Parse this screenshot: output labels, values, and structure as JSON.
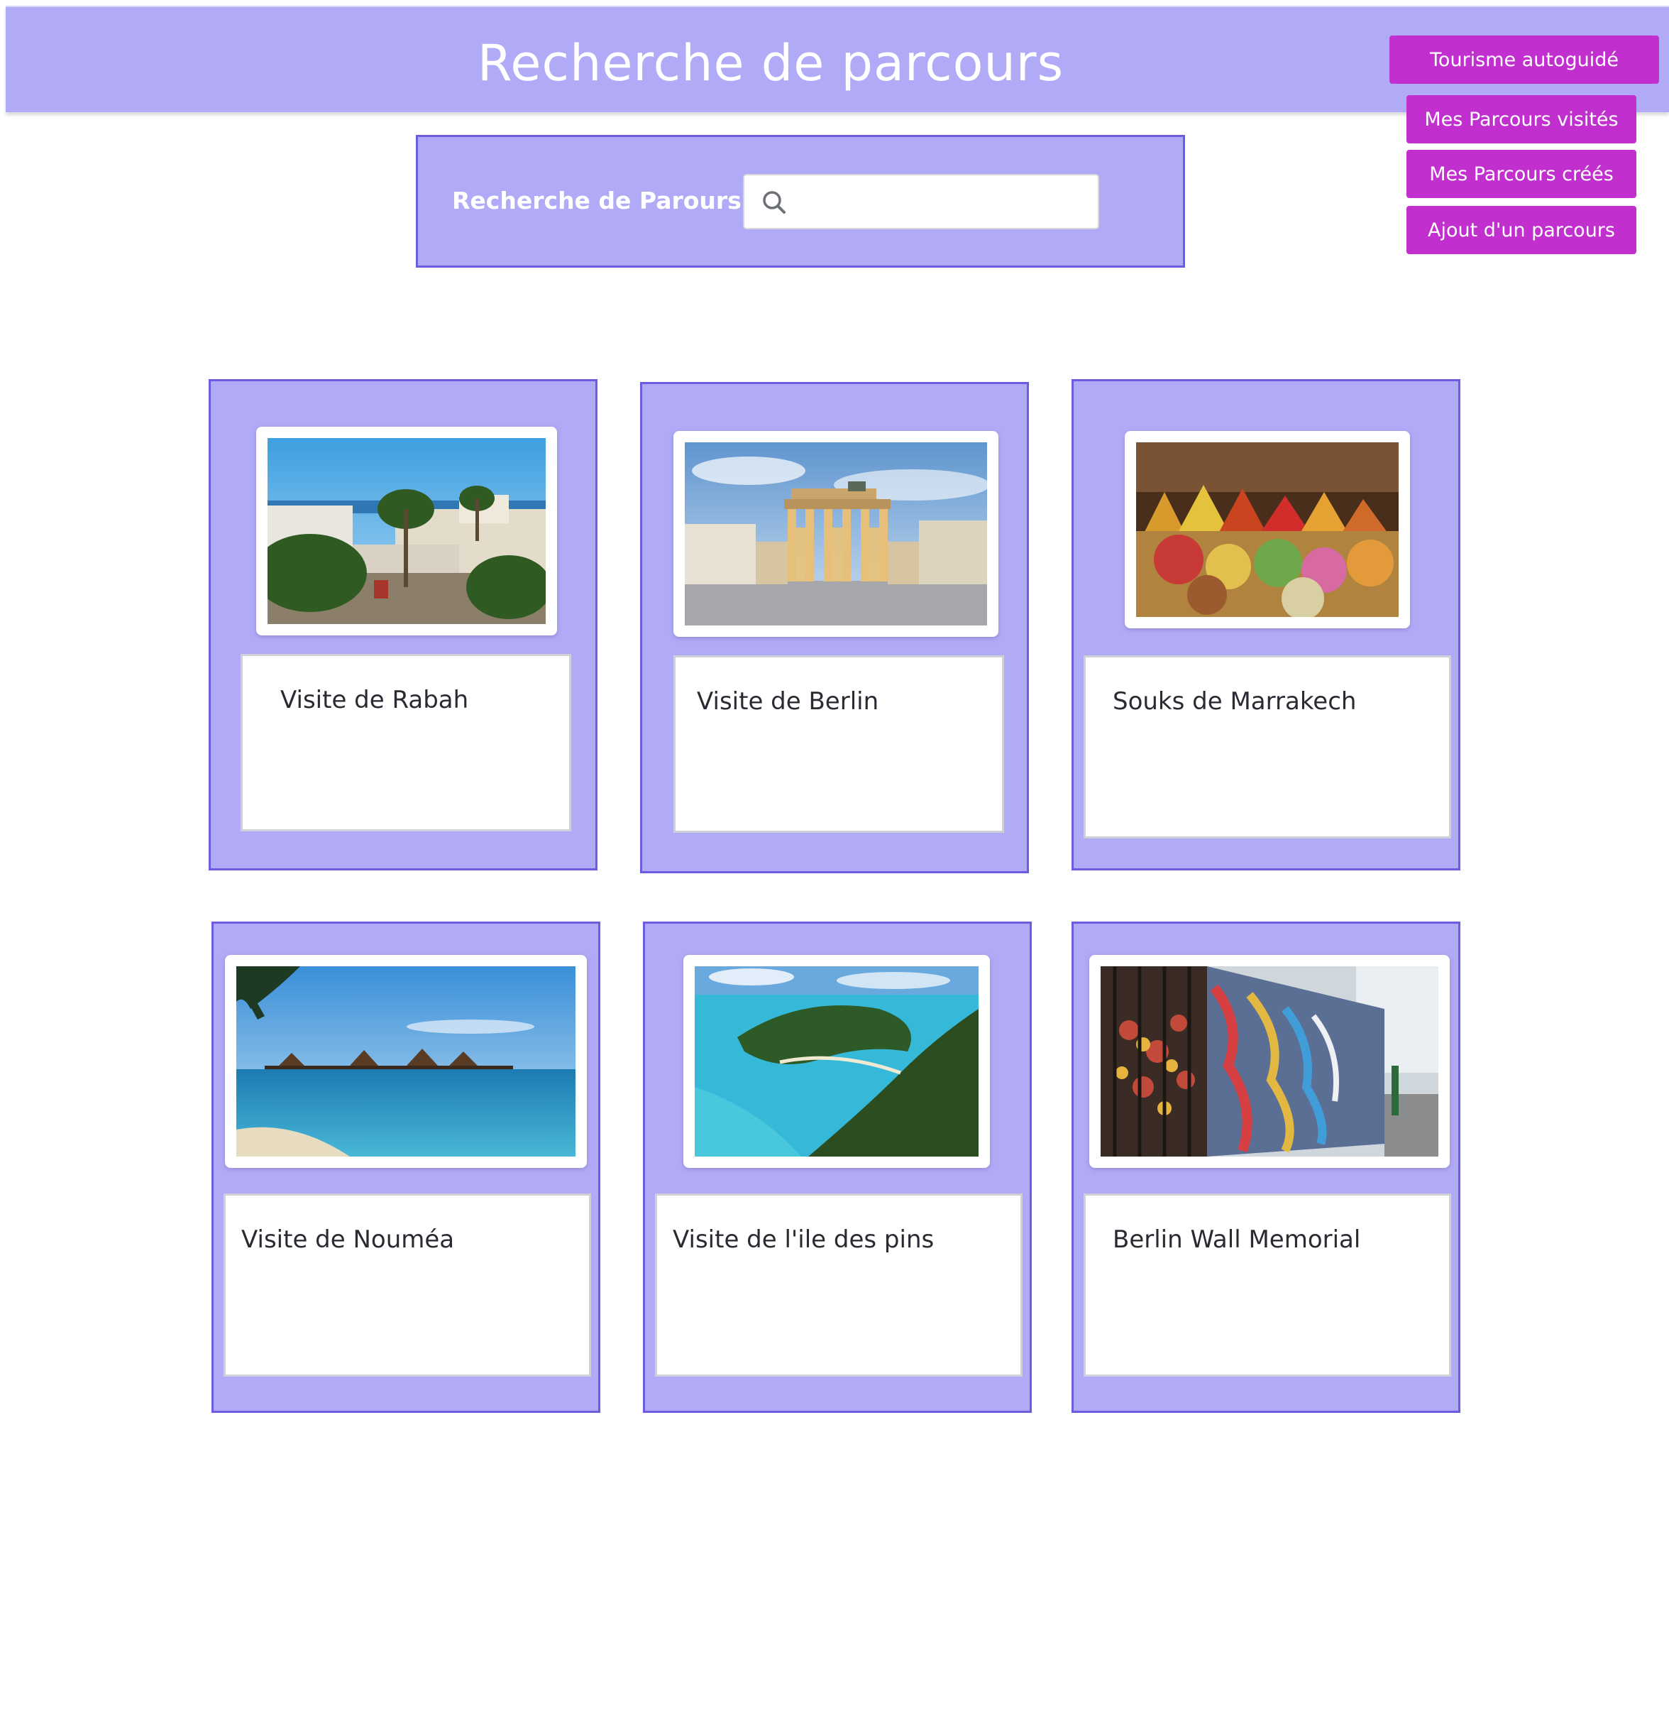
{
  "header": {
    "title": "Recherche de parcours"
  },
  "nav": {
    "tourisme": "Tourisme autoguidé",
    "visites": "Mes Parcours visités",
    "crees": "Mes Parcours créés",
    "ajout": "Ajout d'un parcours"
  },
  "search": {
    "label": "Recherche de Parours",
    "placeholder": "",
    "value": ""
  },
  "cards": [
    {
      "title": "Visite de Rabah",
      "image": "rabat-palm-city-photo"
    },
    {
      "title": "Visite de Berlin",
      "image": "brandenburg-gate-photo"
    },
    {
      "title": "Souks de Marrakech",
      "image": "spice-market-photo"
    },
    {
      "title": "Visite de Nouméa",
      "image": "overwater-bungalows-photo"
    },
    {
      "title": "Visite de l'ile des pins",
      "image": "lagoon-island-photo"
    },
    {
      "title": "Berlin Wall Memorial",
      "image": "berlin-wall-graffiti-photo"
    }
  ],
  "colors": {
    "panel": "#b1aaf7",
    "panel_border": "#6b5ce0",
    "button": "#c130cf",
    "text_dark": "#2a2a33"
  }
}
